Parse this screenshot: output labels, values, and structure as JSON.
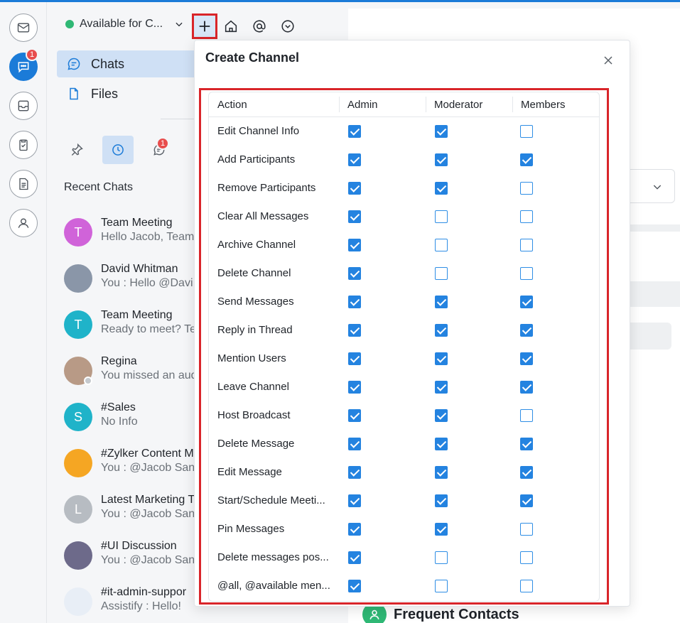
{
  "status": {
    "text": "Available for C...",
    "color": "#2fb875"
  },
  "rail": {
    "chat_badge": "1"
  },
  "nav": {
    "chats": "Chats",
    "files": "Files"
  },
  "subtabs": {
    "threads_badge": "1"
  },
  "recent": {
    "title": "Recent Chats",
    "items": [
      {
        "name": "Team Meeting",
        "preview": "Hello Jacob, Team",
        "initial": "T",
        "color": "#d063d9"
      },
      {
        "name": "David Whitman",
        "preview": "You : Hello @Davi",
        "initial": "",
        "color": "#8a96a8"
      },
      {
        "name": "Team Meeting",
        "preview": "Ready to meet? Te",
        "initial": "T",
        "color": "#1fb3c9"
      },
      {
        "name": "Regina",
        "preview": "You missed an aud",
        "initial": "",
        "color": "#b89a86"
      },
      {
        "name": "#Sales",
        "preview": "No Info",
        "initial": "S",
        "color": "#1fb3c9"
      },
      {
        "name": "#Zylker Content M",
        "preview": "You : @Jacob San",
        "initial": "",
        "color": "#f5a623"
      },
      {
        "name": "Latest Marketing T",
        "preview": "You : @Jacob San",
        "initial": "L",
        "color": "#b7bcc2"
      },
      {
        "name": "#UI Discussion",
        "preview": "You : @Jacob San",
        "initial": "",
        "color": "#6d6a8a"
      },
      {
        "name": "#it-admin-suppor",
        "preview": "Assistify : Hello!",
        "initial": "",
        "color": "#e8eef6"
      }
    ]
  },
  "background": {
    "frequent_contacts": "Frequent Contacts"
  },
  "modal": {
    "title": "Create Channel",
    "columns": [
      "Action",
      "Admin",
      "Moderator",
      "Members"
    ],
    "rows": [
      {
        "action": "Edit Channel Info",
        "admin": true,
        "moderator": true,
        "members": false
      },
      {
        "action": "Add Participants",
        "admin": true,
        "moderator": true,
        "members": true
      },
      {
        "action": "Remove Participants",
        "admin": true,
        "moderator": true,
        "members": false
      },
      {
        "action": "Clear All Messages",
        "admin": true,
        "moderator": false,
        "members": false
      },
      {
        "action": "Archive Channel",
        "admin": true,
        "moderator": false,
        "members": false
      },
      {
        "action": "Delete Channel",
        "admin": true,
        "moderator": false,
        "members": false
      },
      {
        "action": "Send Messages",
        "admin": true,
        "moderator": true,
        "members": true
      },
      {
        "action": "Reply in Thread",
        "admin": true,
        "moderator": true,
        "members": true
      },
      {
        "action": "Mention Users",
        "admin": true,
        "moderator": true,
        "members": true
      },
      {
        "action": "Leave Channel",
        "admin": true,
        "moderator": true,
        "members": true
      },
      {
        "action": "Host Broadcast",
        "admin": true,
        "moderator": true,
        "members": false
      },
      {
        "action": "Delete Message",
        "admin": true,
        "moderator": true,
        "members": true
      },
      {
        "action": "Edit Message",
        "admin": true,
        "moderator": true,
        "members": true
      },
      {
        "action": "Start/Schedule Meeti...",
        "admin": true,
        "moderator": true,
        "members": true
      },
      {
        "action": "Pin Messages",
        "admin": true,
        "moderator": true,
        "members": false
      },
      {
        "action": "Delete messages pos...",
        "admin": true,
        "moderator": false,
        "members": false
      },
      {
        "action": "@all, @available men...",
        "admin": true,
        "moderator": false,
        "members": false
      }
    ]
  },
  "colors": {
    "accent": "#1b7bd8",
    "highlight": "#d9252a",
    "checkbox": "#2483e0"
  }
}
